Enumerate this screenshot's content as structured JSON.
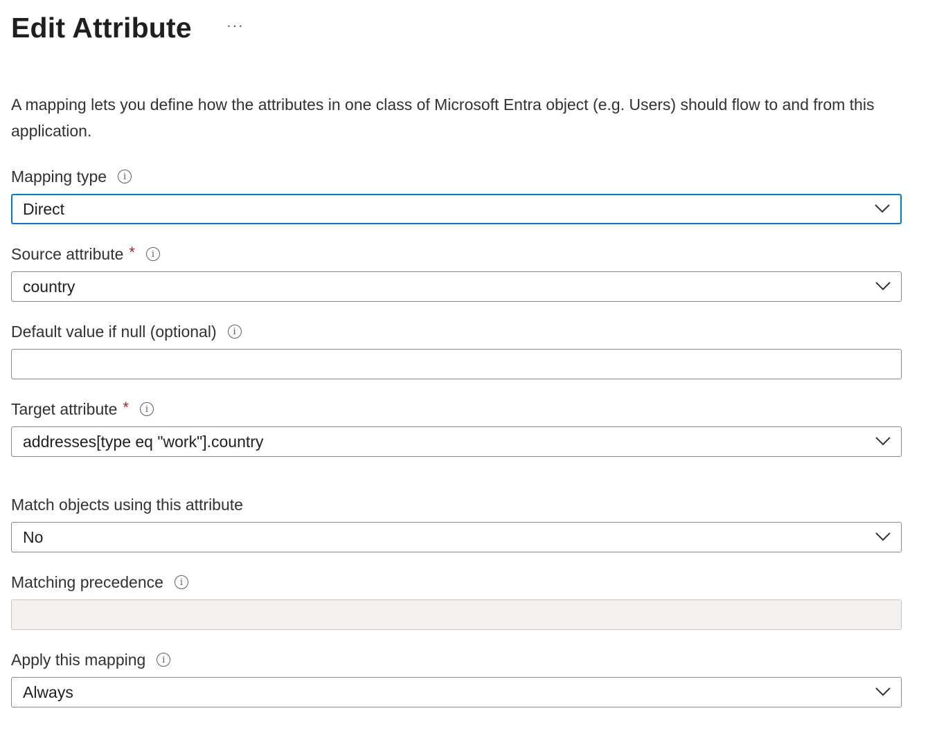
{
  "header": {
    "title": "Edit Attribute",
    "more_label": "···"
  },
  "description": "A mapping lets you define how the attributes in one class of Microsoft Entra object (e.g. Users) should flow to and from this application.",
  "fields": {
    "mapping_type": {
      "label": "Mapping type",
      "value": "Direct",
      "icon": "info-icon"
    },
    "source_attribute": {
      "label": "Source attribute",
      "required_marker": "*",
      "value": "country",
      "icon": "info-icon"
    },
    "default_value": {
      "label": "Default value if null (optional)",
      "value": "",
      "placeholder": "",
      "icon": "info-icon"
    },
    "target_attribute": {
      "label": "Target attribute",
      "required_marker": "*",
      "value": "addresses[type eq \"work\"].country",
      "icon": "info-icon"
    },
    "match_objects": {
      "label": "Match objects using this attribute",
      "value": "No"
    },
    "matching_precedence": {
      "label": "Matching precedence",
      "value": "",
      "icon": "info-icon"
    },
    "apply_mapping": {
      "label": "Apply this mapping",
      "value": "Always",
      "icon": "info-icon"
    }
  },
  "colors": {
    "focus_border": "#0078d4",
    "required": "#a4262c",
    "border": "#8a8886",
    "disabled_bg": "#f3f2f1"
  }
}
